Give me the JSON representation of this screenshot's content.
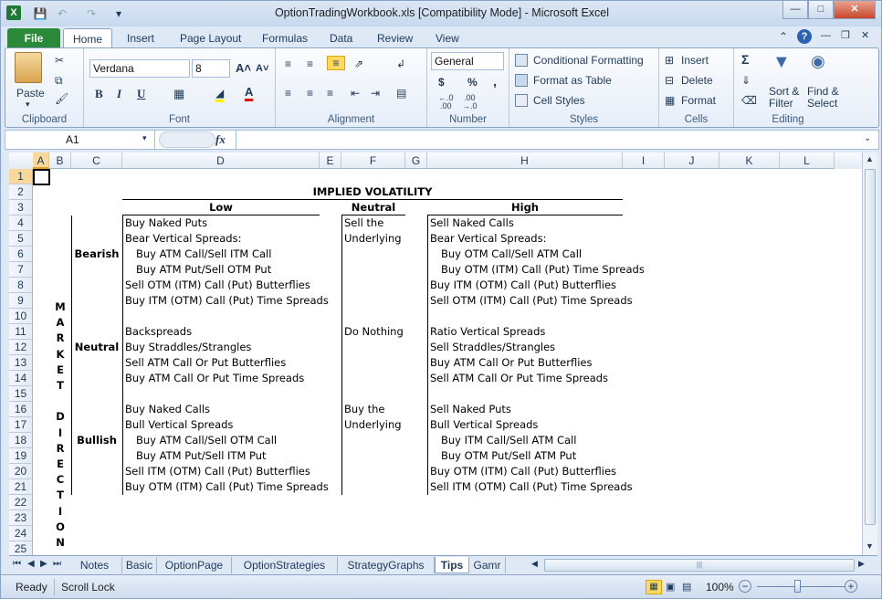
{
  "window": {
    "title": "OptionTradingWorkbook.xls  [Compatibility Mode] - Microsoft Excel"
  },
  "tabs": [
    "File",
    "Home",
    "Insert",
    "Page Layout",
    "Formulas",
    "Data",
    "Review",
    "View"
  ],
  "ribbon": {
    "clipboard": {
      "label": "Clipboard",
      "paste": "Paste"
    },
    "font": {
      "label": "Font",
      "name": "Verdana",
      "size": "8"
    },
    "alignment": {
      "label": "Alignment"
    },
    "number": {
      "label": "Number",
      "format": "General",
      "currency": "$",
      "percent": "%",
      "comma": ","
    },
    "styles": {
      "label": "Styles",
      "conditional": "Conditional Formatting",
      "format_table": "Format as Table",
      "cell_styles": "Cell Styles"
    },
    "cells": {
      "label": "Cells",
      "insert": "Insert",
      "delete": "Delete",
      "format": "Format"
    },
    "editing": {
      "label": "Editing",
      "sort1": "Sort &",
      "sort2": "Filter",
      "find1": "Find &",
      "find2": "Select"
    }
  },
  "formula_bar": {
    "name_box": "A1",
    "fx": "fx",
    "content": ""
  },
  "columns": [
    "A",
    "B",
    "C",
    "D",
    "E",
    "F",
    "G",
    "H",
    "I",
    "J",
    "K",
    "L"
  ],
  "rows": [
    "1",
    "2",
    "3",
    "4",
    "5",
    "6",
    "7",
    "8",
    "9",
    "10",
    "11",
    "12",
    "13",
    "14",
    "15",
    "16",
    "17",
    "18",
    "19",
    "20",
    "21",
    "22",
    "23",
    "24",
    "25"
  ],
  "sheet": {
    "heading": "IMPLIED VOLATILITY",
    "col_low": "Low",
    "col_neutral": "Neutral",
    "col_high": "High",
    "market_direction": [
      "M",
      "A",
      "R",
      "K",
      "E",
      "T",
      "",
      "D",
      "I",
      "R",
      "E",
      "C",
      "T",
      "I",
      "O",
      "N"
    ],
    "bearish": "Bearish",
    "neutral": "Neutral",
    "bullish": "Bullish",
    "low": [
      {
        "row": 4,
        "text": "Buy Naked Puts",
        "indent": false
      },
      {
        "row": 5,
        "text": "Bear Vertical Spreads:",
        "indent": false
      },
      {
        "row": 6,
        "text": "Buy ATM Call/Sell ITM Call",
        "indent": true
      },
      {
        "row": 7,
        "text": "Buy ATM Put/Sell OTM Put",
        "indent": true
      },
      {
        "row": 8,
        "text": "Sell OTM (ITM) Call (Put) Butterflies",
        "indent": false
      },
      {
        "row": 9,
        "text": "Buy ITM (OTM) Call (Put) Time Spreads",
        "indent": false
      },
      {
        "row": 11,
        "text": "Backspreads",
        "indent": false
      },
      {
        "row": 12,
        "text": "Buy Straddles/Strangles",
        "indent": false
      },
      {
        "row": 13,
        "text": "Sell ATM Call Or Put Butterflies",
        "indent": false
      },
      {
        "row": 14,
        "text": "Buy ATM Call Or Put Time Spreads",
        "indent": false
      },
      {
        "row": 16,
        "text": "Buy Naked Calls",
        "indent": false
      },
      {
        "row": 17,
        "text": "Bull Vertical Spreads",
        "indent": false
      },
      {
        "row": 18,
        "text": "Buy ATM Call/Sell OTM Call",
        "indent": true
      },
      {
        "row": 19,
        "text": "Buy ATM Put/Sell ITM Put",
        "indent": true
      },
      {
        "row": 20,
        "text": "Sell ITM (OTM) Call (Put) Butterflies",
        "indent": false
      },
      {
        "row": 21,
        "text": "Buy OTM (ITM) Call (Put) Time Spreads",
        "indent": false
      }
    ],
    "mid": [
      {
        "row": 4,
        "text": "Sell the"
      },
      {
        "row": 5,
        "text": "Underlying"
      },
      {
        "row": 11,
        "text": "Do Nothing"
      },
      {
        "row": 16,
        "text": "Buy the"
      },
      {
        "row": 17,
        "text": "Underlying"
      }
    ],
    "high": [
      {
        "row": 4,
        "text": "Sell Naked Calls",
        "indent": false
      },
      {
        "row": 5,
        "text": "Bear Vertical Spreads:",
        "indent": false
      },
      {
        "row": 6,
        "text": "Buy OTM Call/Sell ATM Call",
        "indent": true
      },
      {
        "row": 7,
        "text": "Buy OTM (ITM) Call (Put) Time Spreads",
        "indent": true
      },
      {
        "row": 8,
        "text": "Buy ITM (OTM) Call (Put) Butterflies",
        "indent": false
      },
      {
        "row": 9,
        "text": "Sell OTM (ITM) Call (Put) Time Spreads",
        "indent": false
      },
      {
        "row": 11,
        "text": "Ratio Vertical Spreads",
        "indent": false
      },
      {
        "row": 12,
        "text": "Sell Straddles/Strangles",
        "indent": false
      },
      {
        "row": 13,
        "text": "Buy ATM Call Or Put Butterflies",
        "indent": false
      },
      {
        "row": 14,
        "text": "Sell ATM Call Or Put Time Spreads",
        "indent": false
      },
      {
        "row": 16,
        "text": "Sell Naked Puts",
        "indent": false
      },
      {
        "row": 17,
        "text": "Bull Vertical Spreads",
        "indent": false
      },
      {
        "row": 18,
        "text": "Buy ITM Call/Sell ATM Call",
        "indent": true
      },
      {
        "row": 19,
        "text": "Buy OTM Put/Sell ATM Put",
        "indent": true
      },
      {
        "row": 20,
        "text": "Buy OTM (ITM) Call (Put) Butterflies",
        "indent": false
      },
      {
        "row": 21,
        "text": "Sell ITM (OTM) Call (Put) Time Spreads",
        "indent": false
      }
    ]
  },
  "sheet_tabs": [
    "Notes",
    "Basic",
    "OptionPage",
    "OptionStrategies",
    "StrategyGraphs",
    "Tips",
    "Gamr"
  ],
  "active_sheet": "Tips",
  "status": {
    "ready": "Ready",
    "scroll_lock": "Scroll Lock",
    "zoom": "100%"
  }
}
